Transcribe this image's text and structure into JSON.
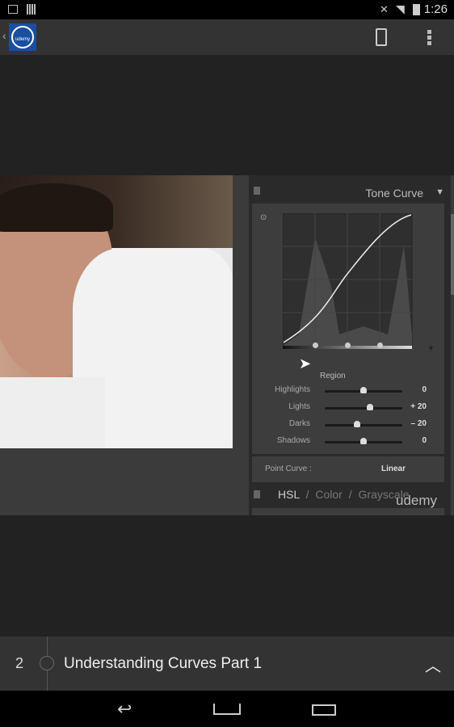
{
  "status_bar": {
    "time": "1:26",
    "icons": [
      "picture-icon",
      "barcode-icon",
      "mute-icon",
      "wifi-icon",
      "battery-charging-icon"
    ]
  },
  "action_bar": {
    "logo_text": "udemy",
    "icons": [
      "back-chevron-icon",
      "tablet-icon",
      "overflow-menu-icon"
    ]
  },
  "video": {
    "panel": {
      "title": "Tone Curve",
      "region_label": "Region",
      "sliders": [
        {
          "label": "Highlights",
          "value": "0",
          "level": 0
        },
        {
          "label": "Lights",
          "value": "+ 20",
          "level": 20
        },
        {
          "label": "Darks",
          "value": "– 20",
          "level": -20
        },
        {
          "label": "Shadows",
          "value": "0",
          "level": 0
        }
      ],
      "point_curve_label": "Point Curve :",
      "point_curve_value": "Linear",
      "next_tabs": [
        "HSL",
        "/",
        "Color",
        "/",
        "Grayscale"
      ]
    },
    "watermark": "udemy"
  },
  "lecture": {
    "number": "2",
    "title": "Understanding Curves Part 1"
  },
  "nav_bar": {
    "icons": [
      "back-icon",
      "home-icon",
      "recents-icon"
    ]
  }
}
